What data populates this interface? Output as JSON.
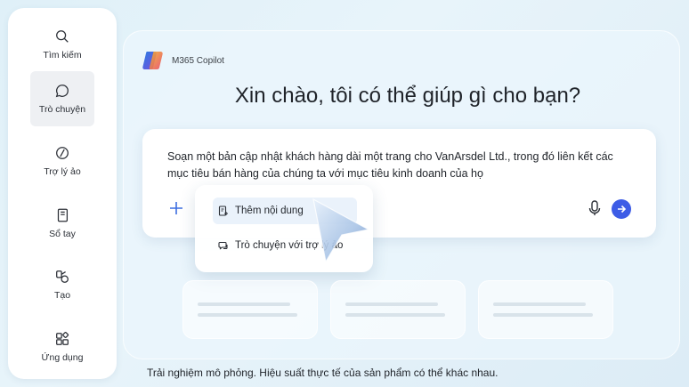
{
  "sidebar": {
    "items": [
      {
        "label": "Tìm kiếm",
        "icon": "search-icon"
      },
      {
        "label": "Trò chuyện",
        "icon": "chat-icon",
        "active": true
      },
      {
        "label": "Trợ lý ảo",
        "icon": "agent-icon"
      },
      {
        "label": "Sổ tay",
        "icon": "notebook-icon"
      },
      {
        "label": "Tạo",
        "icon": "create-icon"
      },
      {
        "label": "Ứng dụng",
        "icon": "apps-icon"
      }
    ]
  },
  "header": {
    "app_name": "M365 Copilot"
  },
  "main": {
    "greeting": "Xin chào, tôi có thể giúp gì cho bạn?",
    "prompt_text": "Soạn một bản cập nhật khách hàng dài một trang cho VanArsdel Ltd., trong đó liên kết các mục tiêu bán hàng của chúng ta với mục tiêu kinh doanh của họ"
  },
  "add_menu": {
    "items": [
      {
        "label": "Thêm nội dung",
        "icon": "add-content-icon",
        "highlighted": true
      },
      {
        "label": "Trò chuyện với trợ lý ảo",
        "icon": "chat-agent-icon"
      }
    ]
  },
  "footer": {
    "disclaimer": "Trải nghiệm mô phỏng. Hiệu suất thực tế của sản phẩm có thể khác nhau."
  },
  "colors": {
    "accent": "#3d5ce6",
    "plus": "#3d6ee0"
  }
}
